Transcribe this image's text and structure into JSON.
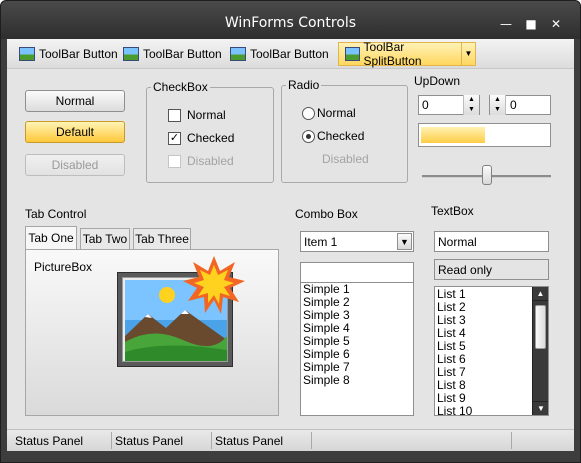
{
  "window": {
    "title": "WinForms Controls"
  },
  "titlebar": {
    "minimize_icon": "minimize-icon",
    "maximize_icon": "maximize-icon",
    "close_icon": "close-icon"
  },
  "toolbar": {
    "buttons": [
      {
        "label": "ToolBar Button",
        "icon": "picture-icon"
      },
      {
        "label": "ToolBar Button",
        "icon": "picture-icon"
      },
      {
        "label": "ToolBar Button",
        "icon": "picture-icon"
      }
    ],
    "split_button": {
      "label": "ToolBar SplitButton",
      "icon": "picture-icon",
      "dropdown_icon": "chevron-down-icon"
    }
  },
  "buttons": {
    "normal": "Normal",
    "default": "Default",
    "disabled": "Disabled"
  },
  "checkbox_group": {
    "title": "CheckBox",
    "items": [
      {
        "label": "Normal",
        "checked": false,
        "enabled": true
      },
      {
        "label": "Checked",
        "checked": true,
        "enabled": true
      },
      {
        "label": "Disabled",
        "checked": false,
        "enabled": false
      }
    ]
  },
  "radio_group": {
    "title": "Radio",
    "items": [
      {
        "label": "Normal",
        "checked": false,
        "enabled": true
      },
      {
        "label": "Checked",
        "checked": true,
        "enabled": true
      },
      {
        "label": "Disabled",
        "checked": false,
        "enabled": false
      }
    ]
  },
  "updown": {
    "title": "UpDown",
    "value1": "0",
    "value2": "0",
    "progress": 0.5,
    "slider": 0.5
  },
  "tab_control": {
    "title": "Tab Control",
    "tabs": [
      "Tab One",
      "Tab Two",
      "Tab Three"
    ],
    "active_tab": 0,
    "picturebox_label": "PictureBox"
  },
  "combo": {
    "title": "Combo Box",
    "selected": "Item 1",
    "simple_value": "",
    "list": [
      "Simple 1",
      "Simple 2",
      "Simple 3",
      "Simple 4",
      "Simple 5",
      "Simple 6",
      "Simple 7",
      "Simple 8"
    ]
  },
  "textbox": {
    "title": "TextBox",
    "normal": "Normal",
    "readonly": "Read only",
    "list": [
      "List 1",
      "List 2",
      "List 3",
      "List 4",
      "List 5",
      "List 6",
      "List 7",
      "List 8",
      "List 9",
      "List 10"
    ]
  },
  "status": {
    "panels": [
      "Status Panel",
      "Status Panel",
      "Status Panel"
    ]
  },
  "colors": {
    "accent": "#ffc83a",
    "titlebar": "#2e2e2e",
    "client": "#e4e4e4"
  }
}
